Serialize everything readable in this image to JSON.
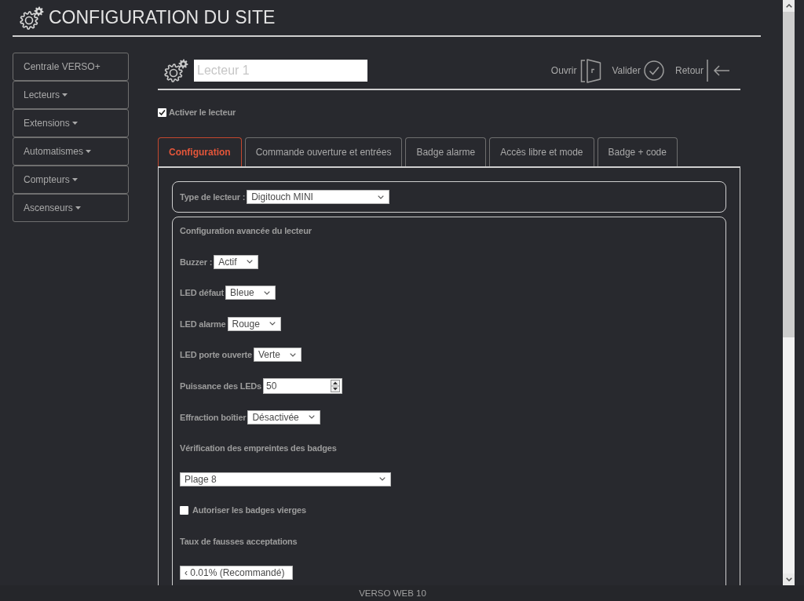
{
  "header": {
    "title": "CONFIGURATION DU SITE"
  },
  "sidebar": {
    "items": [
      {
        "label": "Centrale VERSO+",
        "dropdown": false
      },
      {
        "label": "Lecteurs",
        "dropdown": true
      },
      {
        "label": "Extensions",
        "dropdown": true
      },
      {
        "label": "Automatismes",
        "dropdown": true
      },
      {
        "label": "Compteurs",
        "dropdown": true
      },
      {
        "label": "Ascenseurs",
        "dropdown": true
      }
    ]
  },
  "reader": {
    "name_placeholder": "Lecteur 1",
    "actions": [
      {
        "kind": "open",
        "label": "Ouvrir"
      },
      {
        "kind": "validate",
        "label": "Valider"
      },
      {
        "kind": "back",
        "label": "Retour"
      }
    ],
    "enable": {
      "label": "Activer le lecteur",
      "checked": true
    }
  },
  "tabs": [
    {
      "label": "Configuration",
      "selected": true
    },
    {
      "label": "Commande ouverture et entrées",
      "selected": false
    },
    {
      "label": "Badge alarme",
      "selected": false
    },
    {
      "label": "Accès libre et mode",
      "selected": false
    },
    {
      "label": "Badge + code",
      "selected": false
    }
  ],
  "reader_type": {
    "label": "Type de lecteur :",
    "value": "Digitouch MINI"
  },
  "advanced": {
    "title": "Configuration avancée du lecteur",
    "fields": [
      {
        "kind": "select",
        "label": "Buzzer :",
        "value": "Actif"
      },
      {
        "kind": "select",
        "label": "LED défaut",
        "value": "Bleue"
      },
      {
        "kind": "select",
        "label": "LED alarme",
        "value": "Rouge"
      },
      {
        "kind": "select",
        "label": "LED porte ouverte",
        "value": "Verte"
      },
      {
        "kind": "number",
        "label": "Puissance des LEDs",
        "value": "50"
      },
      {
        "kind": "select",
        "label": "Effraction boîtier",
        "value": "Désactivée"
      },
      {
        "kind": "heading",
        "label": "Vérification des empreintes des badges"
      },
      {
        "kind": "block_select",
        "value": "Plage 8"
      },
      {
        "kind": "checkbox",
        "label": "Autoriser les badges vierges",
        "checked": false
      },
      {
        "kind": "heading",
        "label": "Taux de fausses acceptations"
      },
      {
        "kind": "block_select",
        "value": "‹ 0.01% (Recommandé)"
      }
    ]
  },
  "footer": {
    "text": "VERSO WEB 10"
  }
}
